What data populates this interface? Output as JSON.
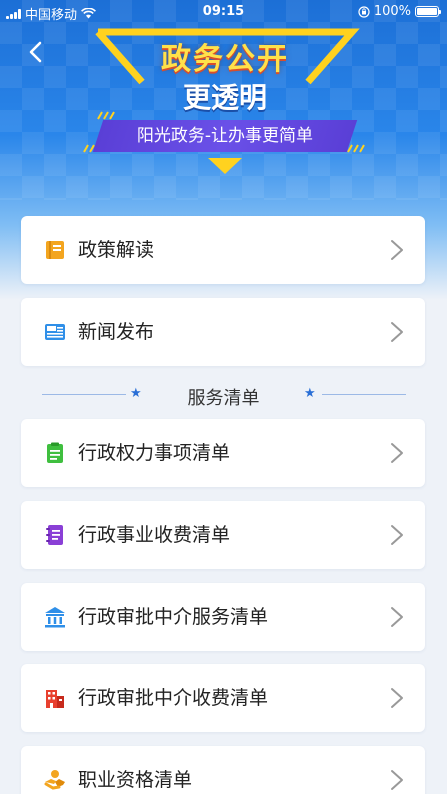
{
  "status_bar": {
    "carrier": "中国移动",
    "time": "09:15",
    "battery": "100%"
  },
  "banner": {
    "title": "政务公开",
    "subtitle": "更透明",
    "slogan": "阳光政务-让办事更简单"
  },
  "top_items": [
    {
      "label": "政策解读",
      "icon": "book-icon"
    },
    {
      "label": "新闻发布",
      "icon": "newspaper-icon"
    }
  ],
  "section": {
    "title": "服务清单"
  },
  "service_items": [
    {
      "label": "行政权力事项清单",
      "icon": "checklist-icon"
    },
    {
      "label": "行政事业收费清单",
      "icon": "bill-icon"
    },
    {
      "label": "行政审批中介服务清单",
      "icon": "government-building-icon"
    },
    {
      "label": "行政审批中介收费清单",
      "icon": "office-building-icon"
    },
    {
      "label": "职业资格清单",
      "icon": "handshake-icon"
    }
  ],
  "colors": {
    "primary": "#1c6fd6",
    "accent_yellow": "#ffe14a",
    "ribbon": "#5a3fd6",
    "background": "#eef2f8"
  }
}
